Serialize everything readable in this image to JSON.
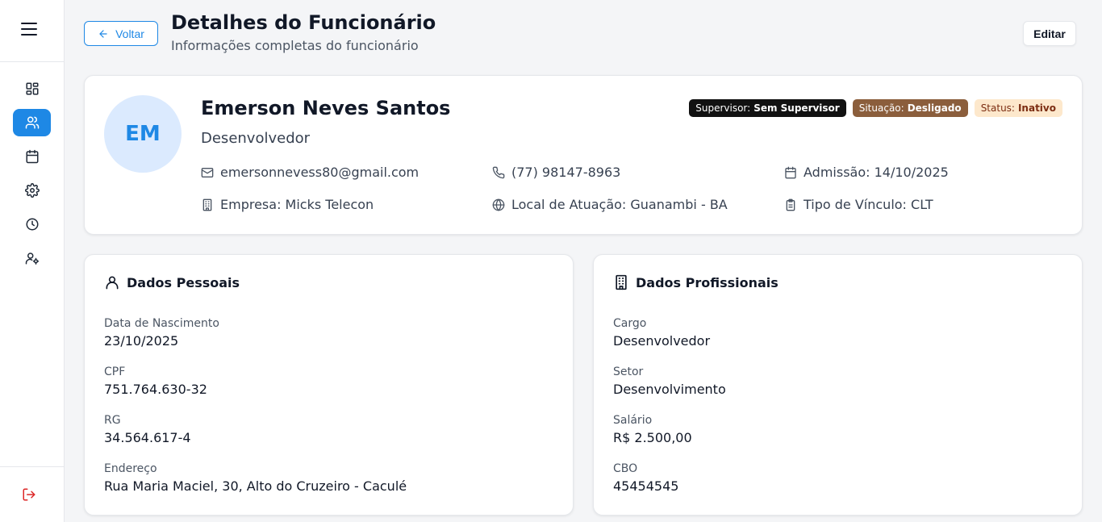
{
  "header": {
    "back_label": "Voltar",
    "title": "Detalhes do Funcionário",
    "subtitle": "Informações completas do funcionário",
    "edit_label": "Editar"
  },
  "sidebar": {
    "items": [
      {
        "icon": "dashboard-icon",
        "active": false
      },
      {
        "icon": "users-icon",
        "active": true
      },
      {
        "icon": "calendar-icon",
        "active": false
      },
      {
        "icon": "gear-icon",
        "active": false
      },
      {
        "icon": "clock-icon",
        "active": false
      },
      {
        "icon": "user-settings-icon",
        "active": false
      }
    ],
    "logout_icon": "logout-icon"
  },
  "profile": {
    "initials": "EM",
    "name": "Emerson Neves Santos",
    "role": "Desenvolvedor",
    "badges": {
      "supervisor_label": "Supervisor:",
      "supervisor_value": "Sem Supervisor",
      "situacao_label": "Situação:",
      "situacao_value": "Desligado",
      "status_label": "Status:",
      "status_value": "Inativo"
    },
    "email": "emersonnevess80@gmail.com",
    "phone": "(77) 98147-8963",
    "admission": "Admissão: 14/10/2025",
    "company": "Empresa: Micks Telecon",
    "location": "Local de Atuação: Guanambi - BA",
    "link_type": "Tipo de Vínculo: CLT"
  },
  "personal": {
    "title": "Dados Pessoais",
    "fields": [
      {
        "label": "Data de Nascimento",
        "value": "23/10/2025"
      },
      {
        "label": "CPF",
        "value": "751.764.630-32"
      },
      {
        "label": "RG",
        "value": "34.564.617-4"
      },
      {
        "label": "Endereço",
        "value": "Rua Maria Maciel, 30, Alto do Cruzeiro - Caculé"
      }
    ]
  },
  "professional": {
    "title": "Dados Profissionais",
    "fields": [
      {
        "label": "Cargo",
        "value": "Desenvolvedor"
      },
      {
        "label": "Setor",
        "value": "Desenvolvimento"
      },
      {
        "label": "Salário",
        "value": "R$ 2.500,00"
      },
      {
        "label": "CBO",
        "value": "45454545"
      }
    ]
  },
  "colors": {
    "accent": "#1e88e5",
    "logout": "#dc2626",
    "badge_supervisor": "#111111",
    "badge_situacao": "#8b5e3c",
    "badge_status": "#fde8cc"
  }
}
